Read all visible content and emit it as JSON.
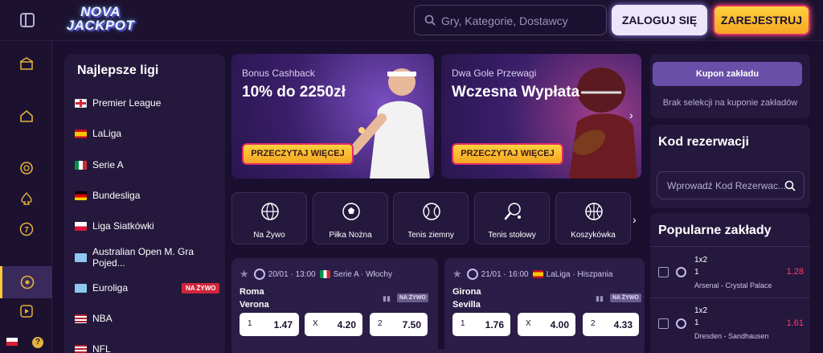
{
  "header": {
    "logo": {
      "line1": "NOVA",
      "line2": "JACKPOT"
    },
    "search_placeholder": "Gry, Kategorie, Dostawcy",
    "login_label": "ZALOGUJ SIĘ",
    "register_label": "ZAREJESTRUJ"
  },
  "sidebar_rail": {
    "items": [
      "casino-building-icon",
      "home-icon",
      "chip-icon",
      "spade-icon",
      "lucky-seven-icon",
      "football-icon",
      "play-icon"
    ],
    "active": "football-icon",
    "help_label": "?"
  },
  "leagues": {
    "title": "Najlepsze ligi",
    "items": [
      {
        "label": "Premier League",
        "flag": "england"
      },
      {
        "label": "LaLiga",
        "flag": "spain"
      },
      {
        "label": "Serie A",
        "flag": "italy"
      },
      {
        "label": "Bundesliga",
        "flag": "germany"
      },
      {
        "label": "Liga Siatkówki",
        "flag": "poland"
      },
      {
        "label": "Australian Open M. Gra Pojed...",
        "flag": "world"
      },
      {
        "label": "Euroliga",
        "flag": "world",
        "badge": "NA ŻYWO"
      },
      {
        "label": "NBA",
        "flag": "usa"
      },
      {
        "label": "NFL",
        "flag": "usa"
      }
    ]
  },
  "promos": [
    {
      "subtitle": "Bonus Cashback",
      "title": "10% do 2250zł",
      "button": "PRZECZYTAJ WIĘCEJ"
    },
    {
      "subtitle": "Dwa Gole Przewagi",
      "title": "Wczesna Wypłata",
      "button": "PRZECZYTAJ WIĘCEJ"
    }
  ],
  "sports": [
    {
      "label": "Na Żywo",
      "icon": "live-globe-icon"
    },
    {
      "label": "Piłka Nożna",
      "icon": "soccer-ball-icon"
    },
    {
      "label": "Tenis ziemny",
      "icon": "tennis-ball-icon"
    },
    {
      "label": "Tenis stołowy",
      "icon": "ping-pong-icon"
    },
    {
      "label": "Koszykówka",
      "icon": "basketball-icon"
    }
  ],
  "matches": [
    {
      "datetime": "20/01 · 13:00",
      "flag": "italy",
      "league": "Serie A · Włochy",
      "home": "Roma",
      "away": "Verona",
      "live": "NA ŻYWO",
      "odds": [
        {
          "label": "1",
          "value": "1.47"
        },
        {
          "label": "X",
          "value": "4.20"
        },
        {
          "label": "2",
          "value": "7.50"
        }
      ]
    },
    {
      "datetime": "21/01 · 16:00",
      "flag": "spain",
      "league": "LaLiga · Hiszpania",
      "home": "Girona",
      "away": "Sevilla",
      "live": "NA ŻYWO",
      "odds": [
        {
          "label": "1",
          "value": "1.76"
        },
        {
          "label": "X",
          "value": "4.00"
        },
        {
          "label": "2",
          "value": "4.33"
        }
      ]
    }
  ],
  "coupon": {
    "button": "Kupon zakładu",
    "empty": "Brak selekcji na kuponie zakładów"
  },
  "reservation": {
    "title": "Kod rezerwacji",
    "placeholder": "Wprowadź Kod Rezerwac..."
  },
  "popular": {
    "title": "Popularne zakłady",
    "bets": [
      {
        "market": "1x2",
        "pick": "1",
        "match": "Arsenal - Crystal Palace",
        "odd": "1.28"
      },
      {
        "market": "1x2",
        "pick": "1",
        "match": "Dresden - Sandhausen",
        "odd": "1.61"
      }
    ]
  }
}
